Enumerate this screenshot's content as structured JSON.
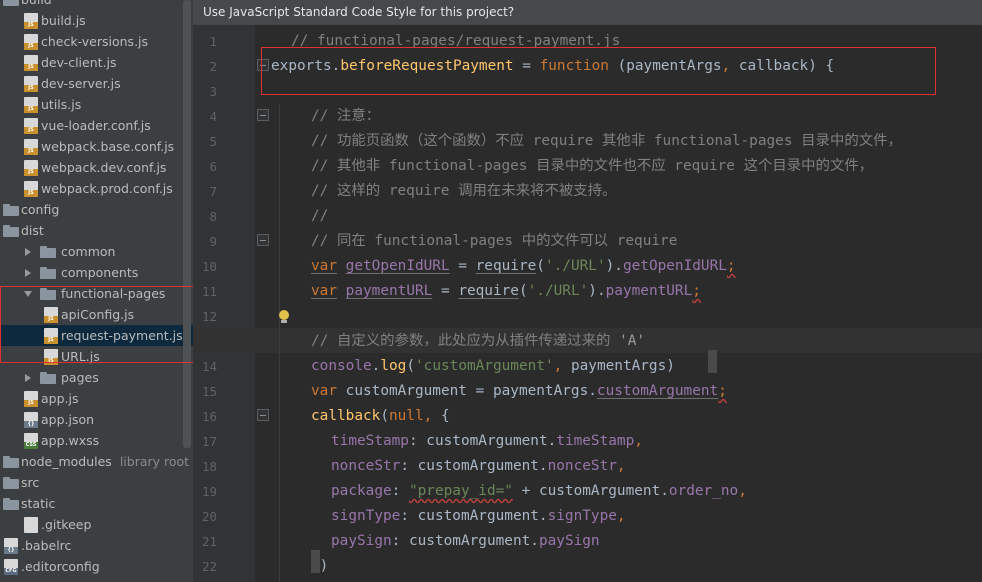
{
  "sidebar": {
    "items": [
      {
        "label": "build",
        "icon": "folder-icon",
        "arrow": "expanded",
        "indent": 0
      },
      {
        "label": "build.js",
        "icon": "js-file-icon",
        "indent": 1
      },
      {
        "label": "check-versions.js",
        "icon": "js-file-icon",
        "indent": 1
      },
      {
        "label": "dev-client.js",
        "icon": "js-file-icon",
        "indent": 1
      },
      {
        "label": "dev-server.js",
        "icon": "js-file-icon",
        "indent": 1
      },
      {
        "label": "utils.js",
        "icon": "js-file-icon",
        "indent": 1
      },
      {
        "label": "vue-loader.conf.js",
        "icon": "js-file-icon",
        "indent": 1
      },
      {
        "label": "webpack.base.conf.js",
        "icon": "js-file-icon",
        "indent": 1
      },
      {
        "label": "webpack.dev.conf.js",
        "icon": "js-file-icon",
        "indent": 1
      },
      {
        "label": "webpack.prod.conf.js",
        "icon": "js-file-icon",
        "indent": 1
      },
      {
        "label": "config",
        "icon": "folder-icon",
        "indent": 0
      },
      {
        "label": "dist",
        "icon": "folder-icon",
        "indent": 0
      },
      {
        "label": "common",
        "icon": "folder-icon",
        "arrow": "collapsed",
        "indent": 1
      },
      {
        "label": "components",
        "icon": "folder-icon",
        "arrow": "collapsed",
        "indent": 1
      },
      {
        "label": "functional-pages",
        "icon": "folder-icon",
        "arrow": "expanded",
        "indent": 1
      },
      {
        "label": "apiConfig.js",
        "icon": "js-file-icon",
        "indent": 2
      },
      {
        "label": "request-payment.js",
        "icon": "js-file-icon",
        "indent": 2,
        "selected": true
      },
      {
        "label": "URL.js",
        "icon": "js-file-icon",
        "indent": 2
      },
      {
        "label": "pages",
        "icon": "folder-icon",
        "arrow": "collapsed",
        "indent": 1
      },
      {
        "label": "app.js",
        "icon": "js-file-icon",
        "indent": 1
      },
      {
        "label": "app.json",
        "icon": "json-file-icon",
        "indent": 1
      },
      {
        "label": "app.wxss",
        "icon": "css-file-icon",
        "indent": 1
      },
      {
        "label": "node_modules",
        "hint": "library root",
        "icon": "folder-icon",
        "indent": 0
      },
      {
        "label": "src",
        "icon": "folder-icon",
        "indent": 0
      },
      {
        "label": "static",
        "icon": "folder-icon",
        "indent": 0
      },
      {
        "label": ".gitkeep",
        "icon": "text-file-icon",
        "indent": 1
      },
      {
        "label": ".babelrc",
        "icon": "json-file-icon",
        "indent": 0
      },
      {
        "label": ".editorconfig",
        "icon": "config-file-icon",
        "indent": 0
      }
    ]
  },
  "editor": {
    "banner": "Use JavaScript Standard Code Style for this project?",
    "lines": [
      {
        "n": "1",
        "indent": 1,
        "tokens": [
          [
            "c-comment",
            "// functional-pages/request-payment.js"
          ]
        ]
      },
      {
        "n": "2",
        "indent": 0,
        "tokens": [
          [
            "c-plain",
            "exports."
          ],
          [
            "c-fn",
            "beforeRequestPayment"
          ],
          [
            "c-plain",
            " = "
          ],
          [
            "c-kw",
            "function"
          ],
          [
            "c-plain",
            " (paymentArgs"
          ],
          [
            "c-kw",
            ","
          ],
          [
            "c-plain",
            " callback) {"
          ]
        ]
      },
      {
        "n": "3",
        "indent": 0,
        "tokens": []
      },
      {
        "n": "4",
        "indent": 2,
        "tokens": [
          [
            "c-comment",
            "// 注意："
          ]
        ]
      },
      {
        "n": "5",
        "indent": 2,
        "tokens": [
          [
            "c-comment",
            "// 功能页函数（这个函数）不应 require 其他非 functional-pages 目录中的文件，"
          ]
        ]
      },
      {
        "n": "6",
        "indent": 2,
        "tokens": [
          [
            "c-comment",
            "// 其他非 functional-pages 目录中的文件也不应 require 这个目录中的文件，"
          ]
        ]
      },
      {
        "n": "7",
        "indent": 2,
        "tokens": [
          [
            "c-comment",
            "// 这样的 require 调用在未来将不被支持。"
          ]
        ]
      },
      {
        "n": "8",
        "indent": 2,
        "tokens": [
          [
            "c-comment",
            "//"
          ]
        ]
      },
      {
        "n": "9",
        "indent": 2,
        "tokens": [
          [
            "c-comment",
            "// 同在 functional-pages 中的文件可以 require"
          ]
        ]
      },
      {
        "n": "10",
        "indent": 2,
        "tokens": [
          [
            "c-kw weak",
            "var"
          ],
          [
            "c-plain",
            " "
          ],
          [
            "c-prop weak",
            "getOpenIdURL"
          ],
          [
            "c-plain",
            " = "
          ],
          [
            "c-plain weak",
            "require"
          ],
          [
            "c-plain",
            "("
          ],
          [
            "c-str",
            "'./URL'"
          ],
          [
            "c-plain",
            ")."
          ],
          [
            "c-prop",
            "getOpenIdURL"
          ],
          [
            "c-kw squiggle",
            ";"
          ]
        ]
      },
      {
        "n": "11",
        "indent": 2,
        "tokens": [
          [
            "c-kw weak",
            "var"
          ],
          [
            "c-plain",
            " "
          ],
          [
            "c-prop weak",
            "paymentURL"
          ],
          [
            "c-plain",
            " = "
          ],
          [
            "c-plain weak",
            "require"
          ],
          [
            "c-plain",
            "("
          ],
          [
            "c-str",
            "'./URL'"
          ],
          [
            "c-plain",
            ")."
          ],
          [
            "c-prop",
            "paymentURL"
          ],
          [
            "c-kw squiggle",
            ";"
          ]
        ]
      },
      {
        "n": "12",
        "indent": 0,
        "tokens": []
      },
      {
        "n": "13",
        "indent": 2,
        "tokens": [
          [
            "c-comment",
            "// 自定义的参数，此处应为从插件传递过来的 "
          ],
          [
            "c-cm",
            "'A'"
          ]
        ]
      },
      {
        "n": "14",
        "indent": 2,
        "tokens": [
          [
            "c-prop",
            "console"
          ],
          [
            "c-plain",
            "."
          ],
          [
            "c-fn",
            "log"
          ],
          [
            "c-plain",
            "("
          ],
          [
            "c-str",
            "'customArgument'"
          ],
          [
            "c-kw",
            ","
          ],
          [
            "c-plain",
            " paymentArgs)"
          ]
        ]
      },
      {
        "n": "15",
        "indent": 2,
        "tokens": [
          [
            "c-kw",
            "var"
          ],
          [
            "c-plain",
            " customArgument = paymentArgs."
          ],
          [
            "c-prop weak",
            "customArgument"
          ],
          [
            "c-kw squiggle",
            ";"
          ]
        ]
      },
      {
        "n": "16",
        "indent": 2,
        "tokens": [
          [
            "c-fn",
            "callback"
          ],
          [
            "c-plain",
            "("
          ],
          [
            "c-kw",
            "null"
          ],
          [
            "c-kw",
            ","
          ],
          [
            "c-plain",
            " {"
          ]
        ]
      },
      {
        "n": "17",
        "indent": 3,
        "tokens": [
          [
            "c-prop",
            "timeStamp"
          ],
          [
            "c-plain",
            ": customArgument."
          ],
          [
            "c-prop",
            "timeStamp"
          ],
          [
            "c-kw",
            ","
          ]
        ]
      },
      {
        "n": "18",
        "indent": 3,
        "tokens": [
          [
            "c-prop",
            "nonceStr"
          ],
          [
            "c-plain",
            ": customArgument."
          ],
          [
            "c-prop",
            "nonceStr"
          ],
          [
            "c-kw",
            ","
          ]
        ]
      },
      {
        "n": "19",
        "indent": 3,
        "tokens": [
          [
            "c-prop",
            "package"
          ],
          [
            "c-plain",
            ": "
          ],
          [
            "c-str squiggle",
            "\"prepay_id=\""
          ],
          [
            "c-plain",
            " + customArgument."
          ],
          [
            "c-prop",
            "order_no"
          ],
          [
            "c-kw",
            ","
          ]
        ]
      },
      {
        "n": "20",
        "indent": 3,
        "tokens": [
          [
            "c-prop",
            "signType"
          ],
          [
            "c-plain",
            ": customArgument."
          ],
          [
            "c-prop",
            "signType"
          ],
          [
            "c-kw",
            ","
          ]
        ]
      },
      {
        "n": "21",
        "indent": 3,
        "tokens": [
          [
            "c-prop",
            "paySign"
          ],
          [
            "c-plain",
            ": customArgument."
          ],
          [
            "c-prop",
            "paySign"
          ]
        ]
      },
      {
        "n": "22",
        "indent": 2,
        "tokens": [
          [
            "c-plain",
            "})"
          ]
        ]
      }
    ]
  },
  "colors": {
    "highlight_border": "#e03030",
    "selection": "#0d293e",
    "keyword": "#cc7832",
    "function": "#ffc66d",
    "string": "#6a8759",
    "property": "#9876aa"
  }
}
